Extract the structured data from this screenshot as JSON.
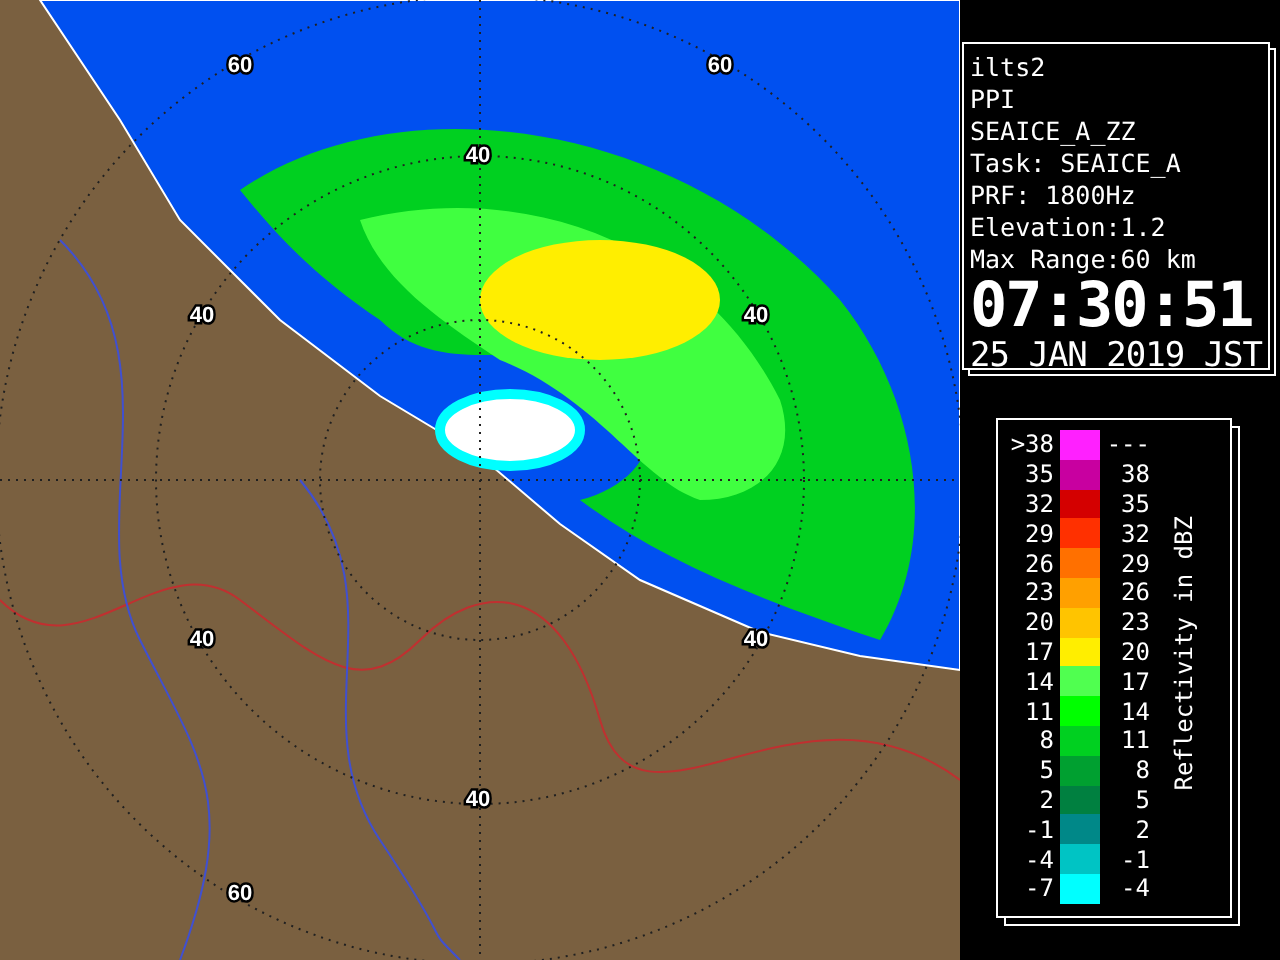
{
  "map": {
    "range_labels": [
      "60",
      "60",
      "40",
      "40",
      "40",
      "40",
      "40",
      "40",
      "60"
    ]
  },
  "info": {
    "lines": [
      "ilts2",
      "PPI",
      "SEAICE_A_ZZ",
      "Task: SEAICE_A",
      "PRF: 1800Hz",
      "Elevation:1.2",
      "Max Range:60 km"
    ],
    "time": "07:30:51",
    "date": "25 JAN 2019 JST"
  },
  "legend": {
    "title": "Reflectivity in dBZ",
    "rows": [
      {
        "low": ">38",
        "high": "---",
        "color": "#ff20ff"
      },
      {
        "low": "35",
        "high": "38",
        "color": "#c800a0"
      },
      {
        "low": "32",
        "high": "35",
        "color": "#d40000"
      },
      {
        "low": "29",
        "high": "32",
        "color": "#ff3000"
      },
      {
        "low": "26",
        "high": "29",
        "color": "#ff7000"
      },
      {
        "low": "23",
        "high": "26",
        "color": "#ffa000"
      },
      {
        "low": "20",
        "high": "23",
        "color": "#ffc400"
      },
      {
        "low": "17",
        "high": "20",
        "color": "#ffee00"
      },
      {
        "low": "14",
        "high": "17",
        "color": "#50ff50"
      },
      {
        "low": "11",
        "high": "14",
        "color": "#00ff00"
      },
      {
        "low": "8",
        "high": "11",
        "color": "#00d020"
      },
      {
        "low": "5",
        "high": "8",
        "color": "#00a030"
      },
      {
        "low": "2",
        "high": "5",
        "color": "#008040"
      },
      {
        "low": "-1",
        "high": "2",
        "color": "#008888"
      },
      {
        "low": "-4",
        "high": "-1",
        "color": "#00c4c4"
      },
      {
        "low": "-7",
        "high": "-4",
        "color": "#00ffff"
      }
    ]
  }
}
